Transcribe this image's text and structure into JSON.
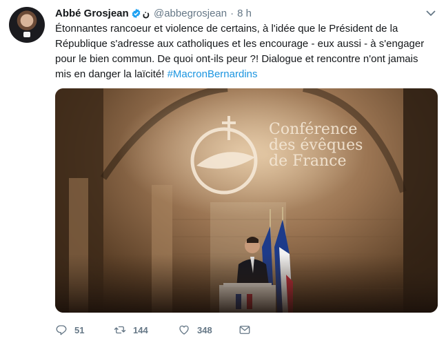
{
  "tweet": {
    "author": {
      "display_name": "Abbé Grosjean",
      "extra_glyph": "ن",
      "handle": "@abbegrosjean",
      "separator": "·",
      "time": "8 h"
    },
    "text": "Étonnantes rancoeur et violence de certains, à l'idée que le Président de la République s'adresse aux catholiques et les encourage - eux aussi - à s'engager pour le bien commun. De quoi ont-ils peur ?! Dialogue et rencontre n'ont jamais mis en danger la laïcité! ",
    "hashtag": "#MacronBernardins",
    "media": {
      "projection_lines": [
        "Conférence",
        "des évêques",
        "de France"
      ]
    },
    "actions": {
      "reply_icon": "reply-icon",
      "reply_count": "51",
      "retweet_icon": "retweet-icon",
      "retweet_count": "144",
      "like_icon": "heart-icon",
      "like_count": "348",
      "dm_icon": "envelope-icon"
    },
    "colors": {
      "link": "#1b95e0",
      "secondary_text": "#657786",
      "verified": "#1da1f2"
    }
  }
}
